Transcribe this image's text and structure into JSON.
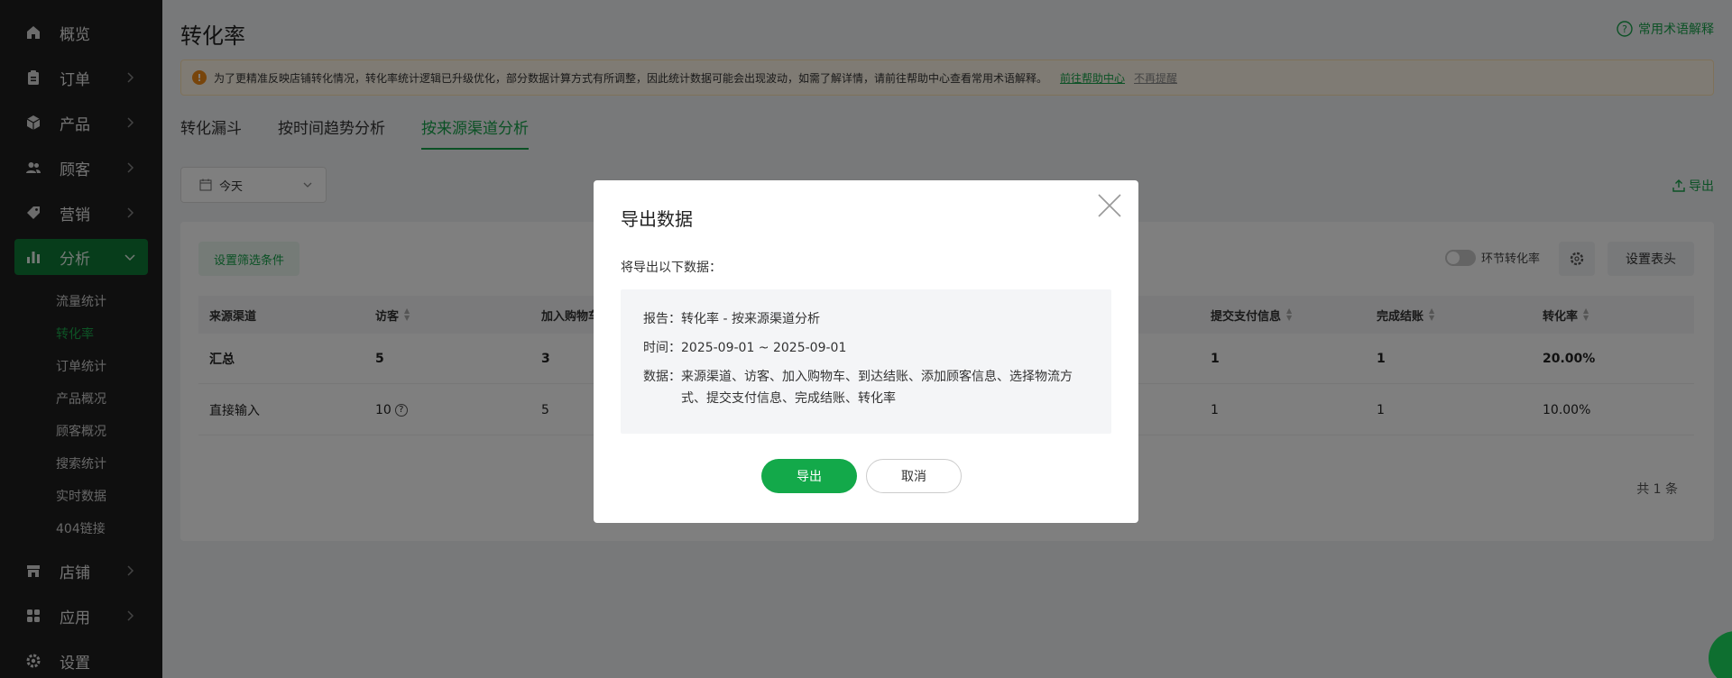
{
  "sidebar": {
    "items": [
      {
        "label": "概览",
        "icon": "home-icon"
      },
      {
        "label": "订单",
        "icon": "clipboard-icon"
      },
      {
        "label": "产品",
        "icon": "box-icon"
      },
      {
        "label": "顾客",
        "icon": "users-icon"
      },
      {
        "label": "营销",
        "icon": "tag-icon"
      },
      {
        "label": "分析",
        "icon": "bar-chart-icon"
      },
      {
        "label": "店铺",
        "icon": "store-icon"
      },
      {
        "label": "应用",
        "icon": "apps-icon"
      },
      {
        "label": "设置",
        "icon": "gear-icon"
      }
    ],
    "sub_items": [
      "流量统计",
      "转化率",
      "订单统计",
      "产品概况",
      "顾客概况",
      "搜索统计",
      "实时数据",
      "404链接"
    ],
    "active_sub": "转化率"
  },
  "header": {
    "title": "转化率",
    "help_link": "常用术语解释"
  },
  "notice": {
    "text": "为了更精准反映店铺转化情况，转化率统计逻辑已升级优化，部分数据计算方式有所调整，因此统计数据可能会出现波动，如需了解详情，请前往帮助中心查看常用术语解释。",
    "help_center_link": "前往帮助中心",
    "dismiss_link": "不再提醒"
  },
  "tabs": [
    {
      "label": "转化漏斗"
    },
    {
      "label": "按时间趋势分析"
    },
    {
      "label": "按来源渠道分析"
    }
  ],
  "date_select": {
    "value": "今天"
  },
  "export_link": "导出",
  "toolbar": {
    "filter_button": "设置筛选条件",
    "toggle_label": "环节转化率",
    "header_button": "设置表头"
  },
  "table": {
    "columns": [
      "来源渠道",
      "访客",
      "加入购物车",
      "提交支付信息",
      "完成结账",
      "转化率"
    ],
    "rows": [
      {
        "channel": "汇总",
        "visitors": "5",
        "cart": "3",
        "payment": "1",
        "checkout": "1",
        "rate": "20.00%"
      },
      {
        "channel": "直接输入",
        "visitors": "10",
        "cart": "5",
        "payment": "1",
        "checkout": "1",
        "rate": "10.00%"
      }
    ],
    "total": "共 1 条"
  },
  "modal": {
    "title": "导出数据",
    "lead": "将导出以下数据：",
    "report_key": "报告：",
    "report_value": "转化率 - 按来源渠道分析",
    "time_key": "时间：",
    "time_value": "2025-09-01 ~ 2025-09-01",
    "data_key": "数据：",
    "data_value": "来源渠道、访客、加入购物车、到达结账、添加顾客信息、选择物流方式、提交支付信息、完成结账、转化率",
    "confirm_button": "导出",
    "cancel_button": "取消"
  },
  "colors": {
    "accent": "#17a34a",
    "sidebar_bg": "#1f1f1f",
    "active_nav_bg": "#0e7a36",
    "warning": "#f08a16"
  }
}
